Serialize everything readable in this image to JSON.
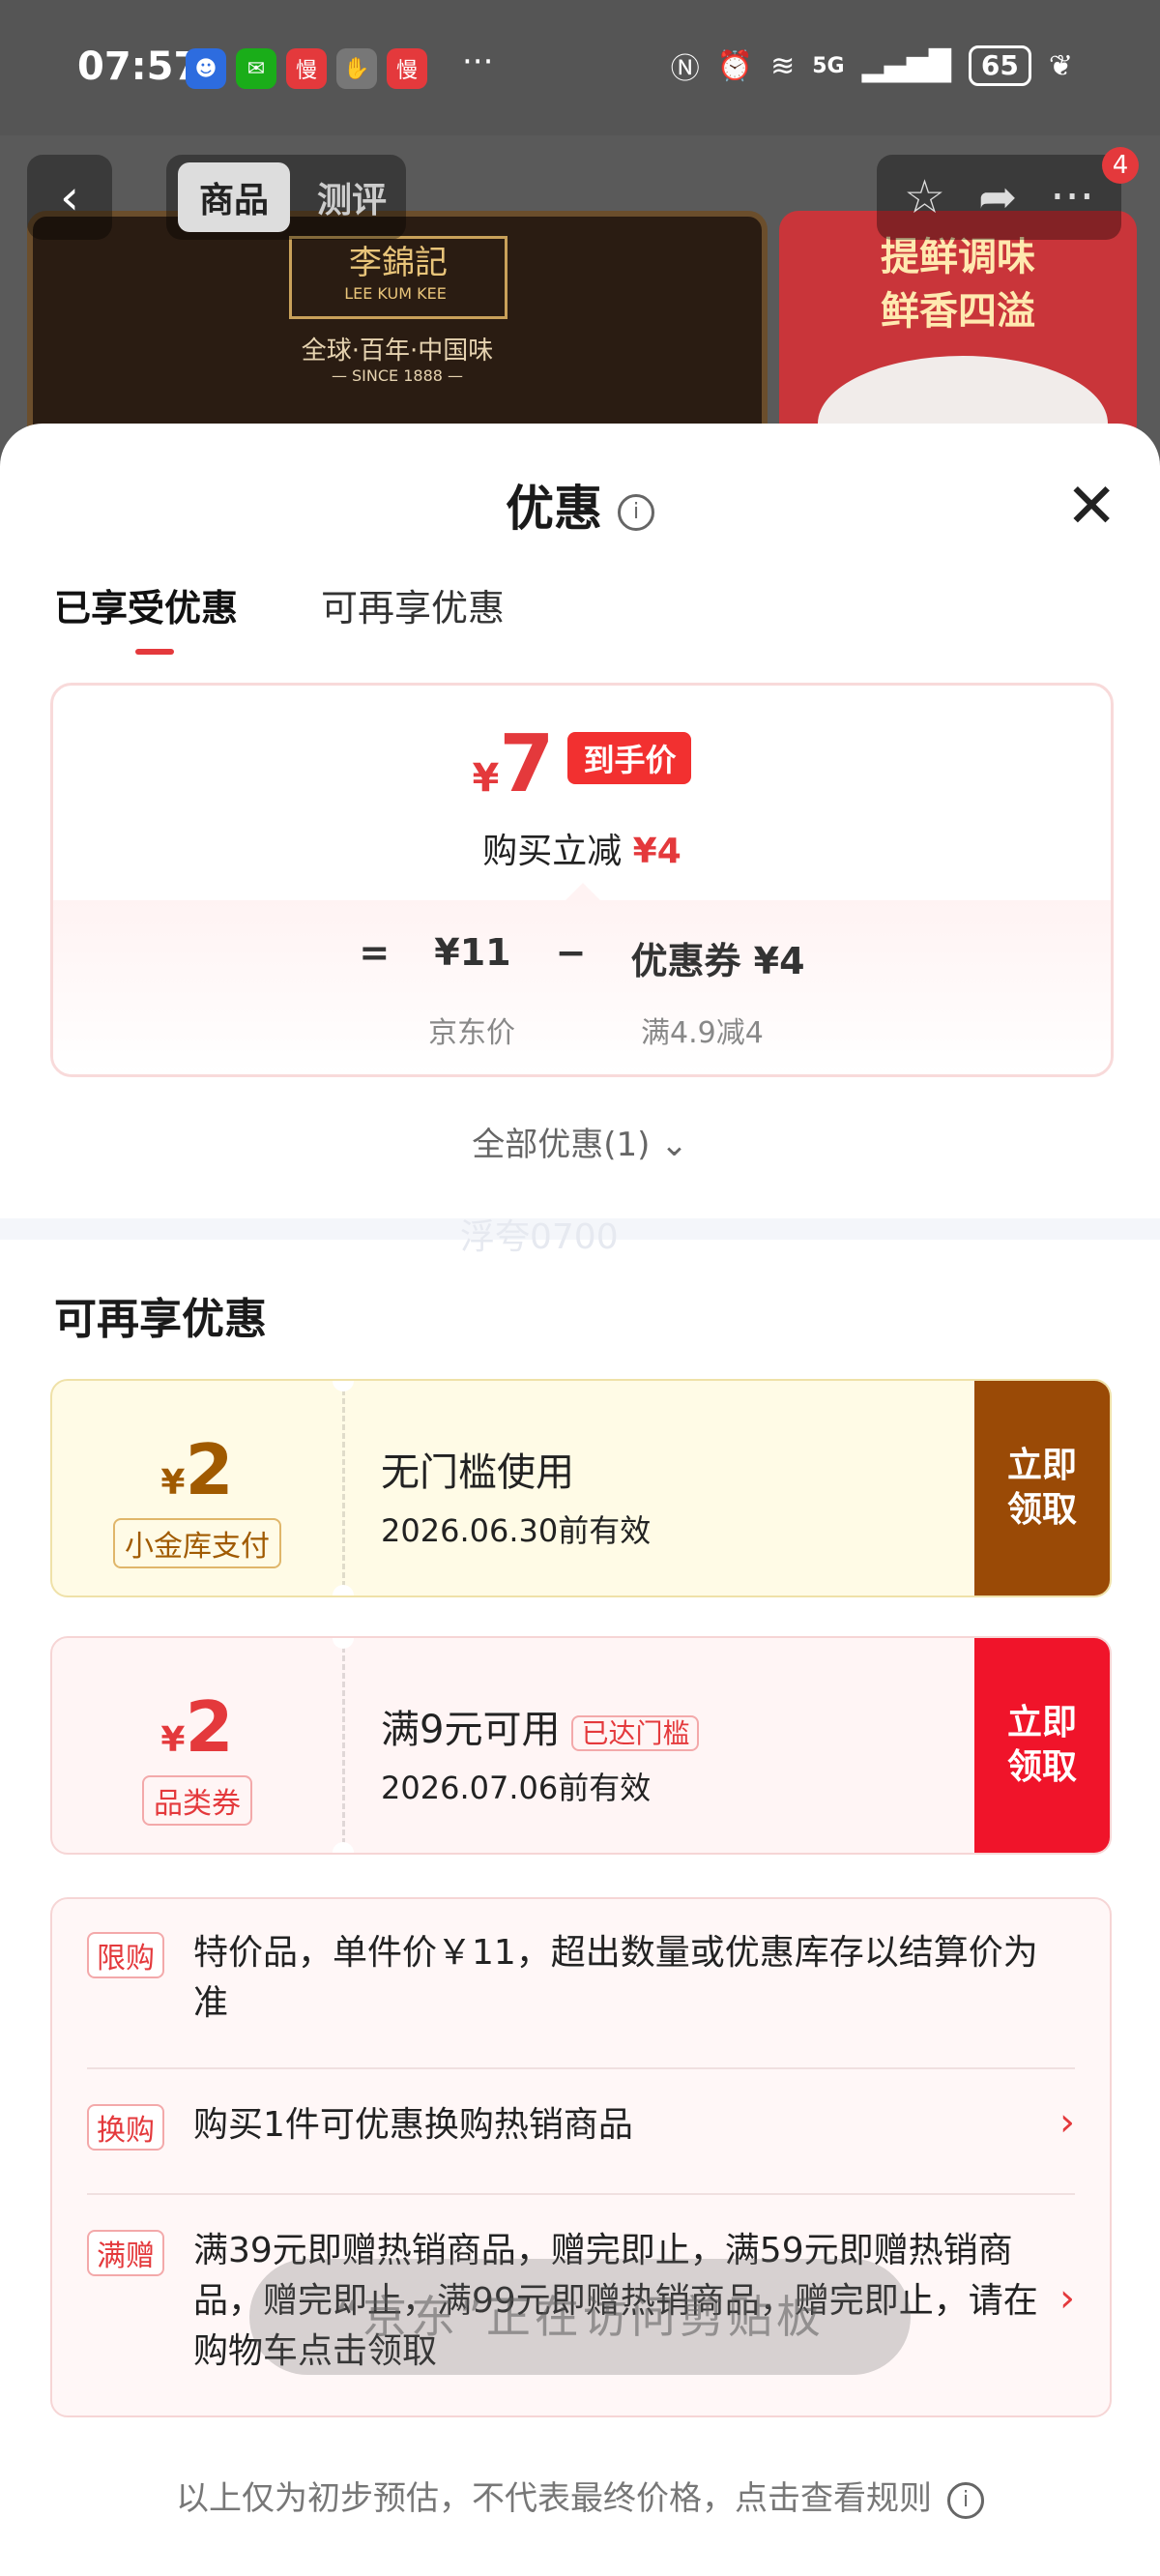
{
  "status_bar": {
    "time": "07:57",
    "more": "···",
    "network": "5G",
    "battery": "65",
    "app_icons": [
      "hello-icon",
      "wechat-icon",
      "slow-icon",
      "hand-icon",
      "slow-icon"
    ]
  },
  "background": {
    "tabs": [
      "商品",
      "测评"
    ],
    "badge": "4",
    "banner_left": {
      "brand": "李錦記",
      "brand_en": "LEE KUM KEE",
      "slogan": "全球·百年·中国味",
      "since": "— SINCE 1888 —"
    },
    "banner_right": {
      "line1": "提鲜调味",
      "line2": "鲜香四溢"
    }
  },
  "sheet": {
    "title": "优惠",
    "tabs": [
      "已享受优惠",
      "可再享优惠"
    ],
    "price_card": {
      "yen": "¥",
      "price": "7",
      "tag": "到手价",
      "subtitle": "购买立减",
      "discount": "¥4",
      "formula": {
        "eq": "=",
        "base": "¥11",
        "minus": "−",
        "coupon": "优惠券 ¥4"
      },
      "labels": {
        "base": "京东价",
        "coupon": "满4.9减4"
      }
    },
    "all_offers": "全部优惠(1)",
    "section_title": "可再享优惠",
    "watermark": "浮夸0700",
    "coupons": [
      {
        "yen": "¥",
        "value": "2",
        "badge": "小金库支付",
        "condition": "无门槛使用",
        "tag": "",
        "date": "2026.06.30前有效",
        "button": "立即领取"
      },
      {
        "yen": "¥",
        "value": "2",
        "badge": "品类券",
        "condition": "满9元可用",
        "tag": "已达门槛",
        "date": "2026.07.06前有效",
        "button": "立即领取"
      }
    ],
    "promos": [
      {
        "tag": "限购",
        "text": "特价品，单件价￥11，超出数量或优惠库存以结算价为准"
      },
      {
        "tag": "换购",
        "text": "购买1件可优惠换购热销商品"
      },
      {
        "tag": "满赠",
        "text": "满39元即赠热销商品，赠完即止，满59元即赠热销商品，赠完即止，满99元即赠热销商品，赠完即止，请在购物车点击领取"
      }
    ],
    "footer": "以上仅为初步预估，不代表最终价格，点击查看规则"
  },
  "toast": "“京东”正在访问剪贴板"
}
